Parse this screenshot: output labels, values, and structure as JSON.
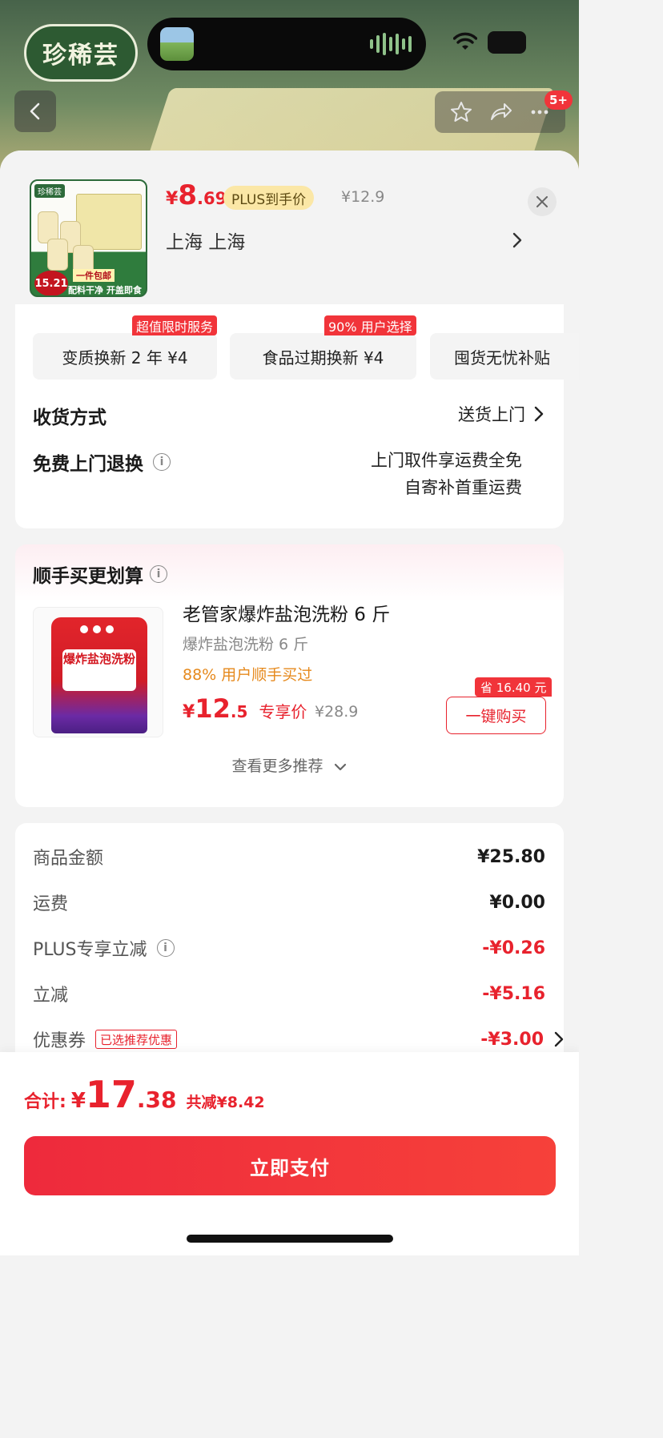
{
  "status_bar": {
    "time": "",
    "battery": ""
  },
  "backdrop": {
    "brand_logo_text": "珍稀芸",
    "cart_badge": "5+"
  },
  "product": {
    "image_brand": "珍稀芸",
    "image_free_shipping": "一件包邮",
    "image_price_tag": "15.21",
    "image_slogan": "配料干净 开盖即食",
    "price_currency": "¥",
    "price_int": "8",
    "price_dec": ".69",
    "plus_label": "PLUS到手价",
    "original_price": "¥12.9",
    "address": "上海  上海"
  },
  "services": [
    {
      "label": "变质换新 2 年   ¥4",
      "badge": "超值限时服务"
    },
    {
      "label": "食品过期换新   ¥4",
      "badge": "90% 用户选择"
    },
    {
      "label": "囤货无忧补贴"
    }
  ],
  "delivery": {
    "label": "收货方式",
    "value": "送货上门"
  },
  "free_return": {
    "label": "免费上门退换",
    "line1": "上门取件享运费全免",
    "line2": "自寄补首重运费"
  },
  "recommend": {
    "title": "顺手买更划算",
    "item": {
      "image_text": "爆炸盐泡洗粉",
      "name": "老管家爆炸盐泡洗粉 6 斤",
      "subtitle": "爆炸盐泡洗粉 6 斤",
      "popularity": "88% 用户顺手买过",
      "price_currency": "¥",
      "price_int": "12",
      "price_dec": ".5",
      "price_label": "专享价",
      "original_price": "¥28.9",
      "save_badge": "省 16.40 元",
      "buy_label": "一键购买"
    },
    "more_label": "查看更多推荐"
  },
  "summary": [
    {
      "label": "商品金额",
      "value": "¥25.80"
    },
    {
      "label": "运费",
      "value": "¥0.00"
    },
    {
      "label": "PLUS专享立减",
      "value": "-¥0.26"
    },
    {
      "label": "立减",
      "value": "-¥5.16"
    },
    {
      "label": "优惠券",
      "tag": "已选推荐优惠",
      "value": "-¥3.00"
    }
  ],
  "footer": {
    "total_label": "合计:",
    "currency": "¥",
    "total_int": "17",
    "total_dec": ".38",
    "discount_text": "共减¥8.42",
    "pay_label": "立即支付"
  },
  "colors": {
    "accent": "#e8222d",
    "badge": "#f1343a",
    "plus_tag_bg": "#fbe7a6",
    "popularity": "#e6891c"
  }
}
